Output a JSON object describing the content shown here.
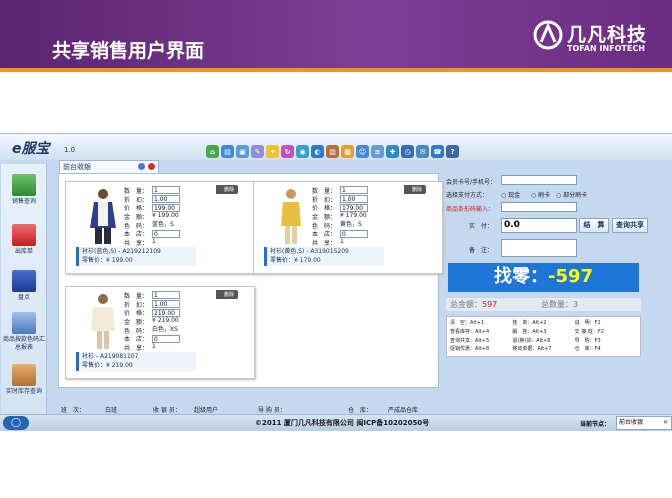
{
  "banner": {
    "title": "共享销售用户界面",
    "logo_cn": "几凡科技",
    "logo_en": "TOFAN INFOTECH"
  },
  "app": {
    "brand": "e服宝",
    "version": "1.0",
    "tab_label": "前台收银"
  },
  "sidebar": {
    "items": [
      {
        "label": "销售查询",
        "icon": "chart-icon"
      },
      {
        "label": "出库单",
        "icon": "upload-icon"
      },
      {
        "label": "盘点",
        "icon": "checklist-icon"
      },
      {
        "label": "商品按款色码汇总报表",
        "icon": "report-icon"
      },
      {
        "label": "实时库存查询",
        "icon": "box-icon"
      }
    ]
  },
  "cards": [
    {
      "labels": [
        "数　量：",
        "折　扣：",
        "价　格：",
        "金　额：",
        "色　码：",
        "本　店：",
        "共　享："
      ],
      "values": [
        "1",
        "1.00",
        "199.00",
        "¥ 199.00",
        "蓝色，S",
        "0",
        "1"
      ],
      "name": "衬衫(蓝色,S) - A219212109",
      "price": "零售价：¥ 199.00",
      "delete": "删除"
    },
    {
      "labels": [
        "数　量：",
        "折　扣：",
        "价　格：",
        "金　额：",
        "色　码：",
        "本　店：",
        "共　享："
      ],
      "values": [
        "1",
        "1.00",
        "179.00",
        "¥ 179.00",
        "黄色，S",
        "0",
        "1"
      ],
      "name": "衬衫(黄色,S) - A319015209",
      "price": "零售价：¥ 179.00",
      "delete": "删除"
    },
    {
      "labels": [
        "数　量：",
        "折　扣：",
        "价　格：",
        "金　额：",
        "色　码：",
        "本　店：",
        "共　享："
      ],
      "values": [
        "1",
        "1.00",
        "219.00",
        "¥ 219.00",
        "白色，XS",
        "0",
        "1"
      ],
      "name": "衬衫 - A219081107",
      "price": "零售价：¥ 219.00",
      "delete": "删除"
    }
  ],
  "right": {
    "member_label": "会员卡号/手机号：",
    "pay_label": "选择支付方式：",
    "pay_options": [
      "现金",
      "刷卡",
      "部分刷卡"
    ],
    "barcode_label": "商品条形码输入：",
    "paid_label": "实　付：",
    "paid_value": "0.0",
    "settle_btn": "结　算",
    "share_btn": "查询共享",
    "note_label": "备　注：",
    "change_label": "找零：",
    "change_value": "-597",
    "total_amount_label": "总金额：",
    "total_amount": "597",
    "total_qty_label": "总数量：",
    "total_qty": "3",
    "hotkeys": [
      "清　空：Alt+1",
      "挂　单：Alt+2",
      "说　明：F1",
      "查看库存：Alt+4",
      "解　挂：Alt+3",
      "交 接 班：F2",
      "查询共享：Alt+5",
      "退(换)货：Alt+6",
      "导　购：F3",
      "促销优惠：Alt+8",
      "移动单据：Alt+7",
      "仓　库：F4"
    ]
  },
  "footer": {
    "shift_label": "班　次：",
    "shift": "白班",
    "cashier_label": "收 银 员：",
    "cashier": "超级用户",
    "guide_label": "导 购 员：",
    "warehouse_label": "仓　库：",
    "warehouse": "严成品仓库"
  },
  "status": {
    "copyright": "©2011 厦门几凡科技有限公司 闽ICP备10202050号",
    "current_node": "当前节点：",
    "task": "前台收银"
  },
  "colors": {
    "banner": "#6a2d82",
    "accent": "#f29320",
    "change_bg": "#1e77d8",
    "change_value": "#ffff00"
  }
}
